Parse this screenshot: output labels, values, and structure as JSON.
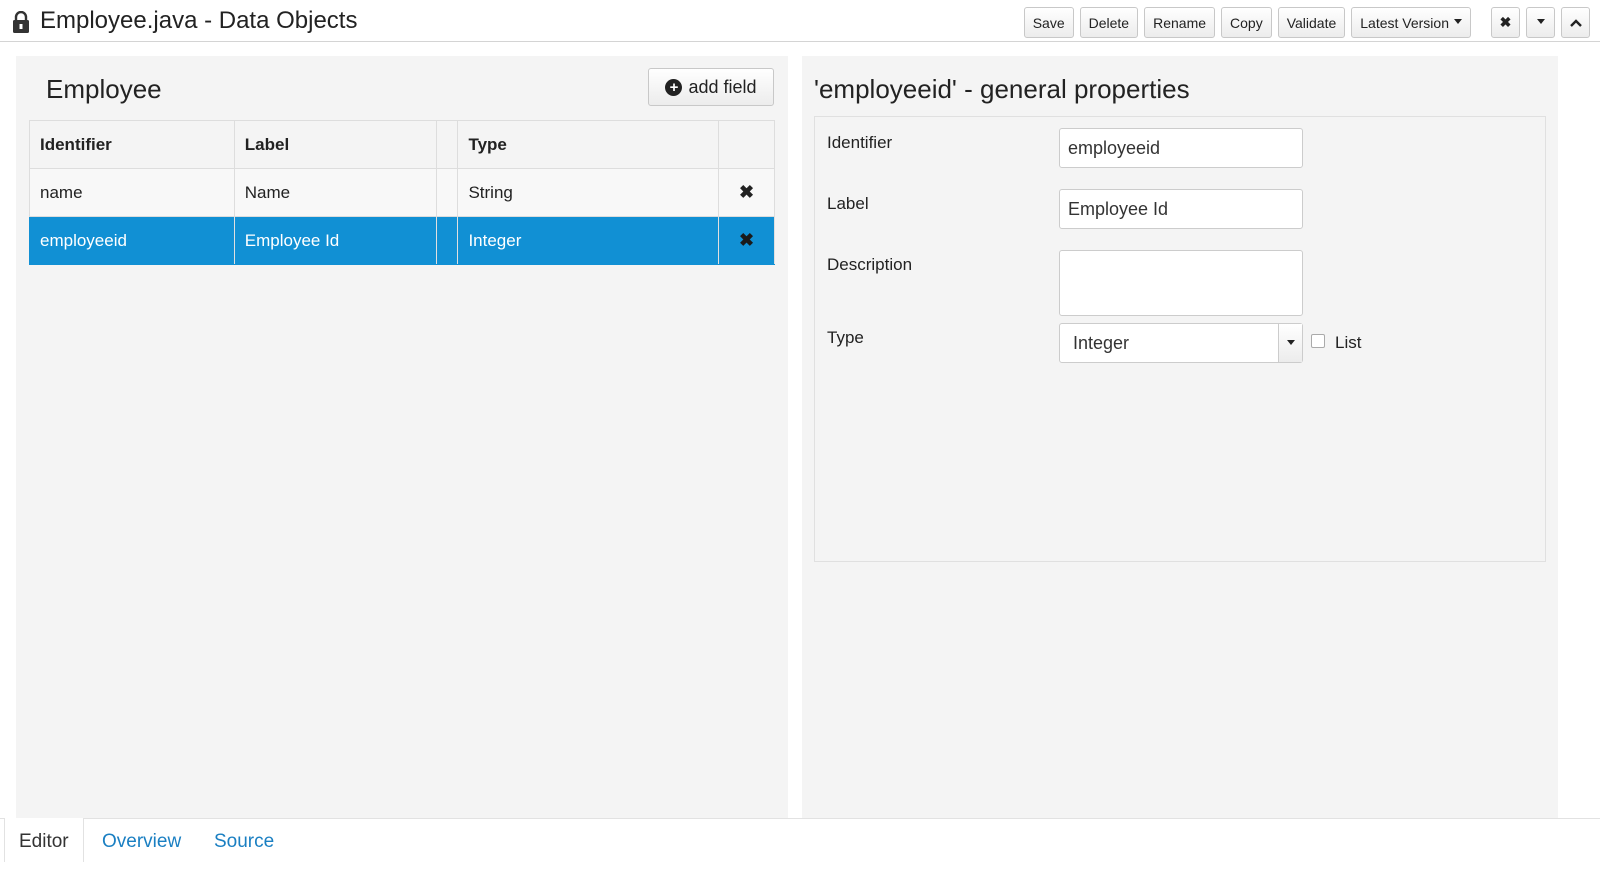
{
  "window": {
    "title": "Employee.java - Data Objects",
    "lock_icon": "lock-icon"
  },
  "toolbar": {
    "save": "Save",
    "delete": "Delete",
    "rename": "Rename",
    "copy": "Copy",
    "validate": "Validate",
    "latest_version": "Latest Version",
    "close_icon": "close-icon",
    "collapse_menu_icon": "chevron-down-icon",
    "maximize_icon": "chevron-up-icon"
  },
  "left": {
    "heading": "Employee",
    "add_field": "add field",
    "add_field_icon": "plus-circle-icon",
    "columns": [
      "Identifier",
      "Label",
      "",
      "Type",
      ""
    ],
    "rows": [
      {
        "identifier": "name",
        "label": "Name",
        "type": "String",
        "selected": false
      },
      {
        "identifier": "employeeid",
        "label": "Employee Id",
        "type": "Integer",
        "selected": true
      }
    ],
    "selected_color": "#1190d4"
  },
  "right": {
    "title": "'employeeid' - general properties",
    "identifier_label": "Identifier",
    "identifier_value": "employeeid",
    "label_label": "Label",
    "label_value": "Employee Id",
    "description_label": "Description",
    "description_value": "",
    "type_label": "Type",
    "type_value": "Integer",
    "list_label": "List",
    "list_checked": false
  },
  "tabs": {
    "editor": "Editor",
    "overview": "Overview",
    "source": "Source",
    "active": "editor"
  }
}
